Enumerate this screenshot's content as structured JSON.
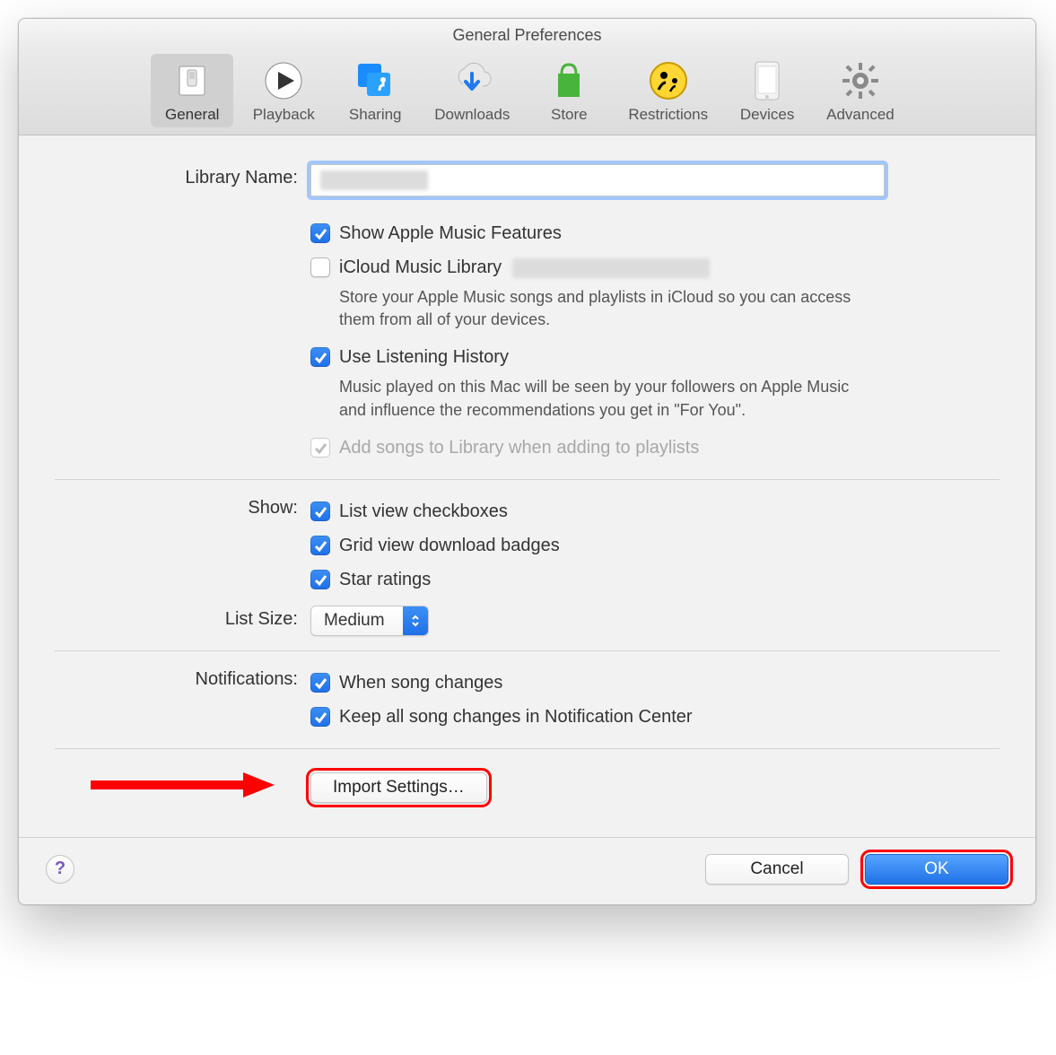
{
  "window": {
    "title": "General Preferences"
  },
  "toolbar": {
    "tabs": [
      {
        "label": "General",
        "selected": true
      },
      {
        "label": "Playback",
        "selected": false
      },
      {
        "label": "Sharing",
        "selected": false
      },
      {
        "label": "Downloads",
        "selected": false
      },
      {
        "label": "Store",
        "selected": false
      },
      {
        "label": "Restrictions",
        "selected": false
      },
      {
        "label": "Devices",
        "selected": false
      },
      {
        "label": "Advanced",
        "selected": false
      }
    ]
  },
  "labels": {
    "library_name": "Library Name:",
    "show": "Show:",
    "list_size": "List Size:",
    "notifications": "Notifications:"
  },
  "library": {
    "name_value": "",
    "show_apple_music": {
      "checked": true,
      "label": "Show Apple Music Features"
    },
    "icloud_library": {
      "checked": false,
      "label": "iCloud Music Library",
      "suffix_redacted": true
    },
    "icloud_desc": "Store your Apple Music songs and playlists in iCloud so you can access them from all of your devices.",
    "listening_history": {
      "checked": true,
      "label": "Use Listening History"
    },
    "listening_desc": "Music played on this Mac will be seen by your followers on Apple Music and influence the recommendations you get in \"For You\".",
    "add_to_library": {
      "checked": true,
      "disabled": true,
      "label": "Add songs to Library when adding to playlists"
    }
  },
  "show": {
    "list_checkboxes": {
      "checked": true,
      "label": "List view checkboxes"
    },
    "grid_badges": {
      "checked": true,
      "label": "Grid view download badges"
    },
    "star_ratings": {
      "checked": true,
      "label": "Star ratings"
    }
  },
  "list_size": {
    "value": "Medium"
  },
  "notifications": {
    "song_changes": {
      "checked": true,
      "label": "When song changes"
    },
    "keep_in_center": {
      "checked": true,
      "label": "Keep all song changes in Notification Center"
    }
  },
  "buttons": {
    "import_settings": "Import Settings…",
    "cancel": "Cancel",
    "ok": "OK",
    "help": "?"
  },
  "annotation": {
    "arrow_points_to": "import-settings-button",
    "highlighted_buttons": [
      "import-settings-button",
      "ok-button"
    ]
  }
}
